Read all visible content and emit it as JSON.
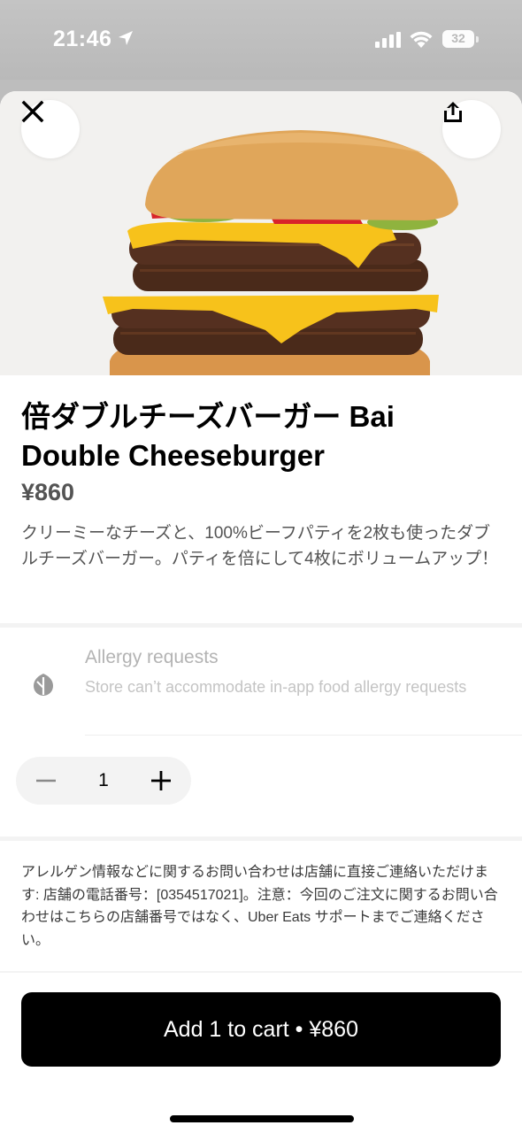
{
  "status_bar": {
    "time": "21:46",
    "battery": "32",
    "icons": [
      "location-arrow-icon",
      "cellular-signal-icon",
      "wifi-icon",
      "battery-icon"
    ]
  },
  "header": {
    "close_icon": "close-icon",
    "share_icon": "share-icon"
  },
  "product": {
    "title": "倍ダブルチーズバーガー Bai Double Cheeseburger",
    "price": "¥860",
    "description": "クリーミーなチーズと、100%ビーフパティを2枚も使ったダブルチーズバーガー。パティを倍にして4枚にボリュームアップ！"
  },
  "allergy": {
    "icon": "allergy-icon",
    "title": "Allergy requests",
    "subtitle": "Store can’t accommodate in-app food allergy requests"
  },
  "quantity": {
    "value": "1",
    "minus_icon": "minus-icon",
    "plus_icon": "plus-icon"
  },
  "info_text": "アレルゲン情報などに関するお問い合わせは店舗に直接ご連絡いただけます: 店舗の電話番号：[0354517021]。注意：今回のご注文に関するお問い合わせはこちらの店舗番号ではなく、Uber Eats サポートまでご連絡ください。",
  "cart_button": {
    "label": "Add 1 to cart • ¥860"
  },
  "colors": {
    "primary": "#000000",
    "price_gray": "#545454",
    "disabled_gray": "#b3b3b3",
    "surface_gray": "#f3f3f3",
    "cheese": "#f7c21b",
    "bun": "#e0a65a"
  }
}
